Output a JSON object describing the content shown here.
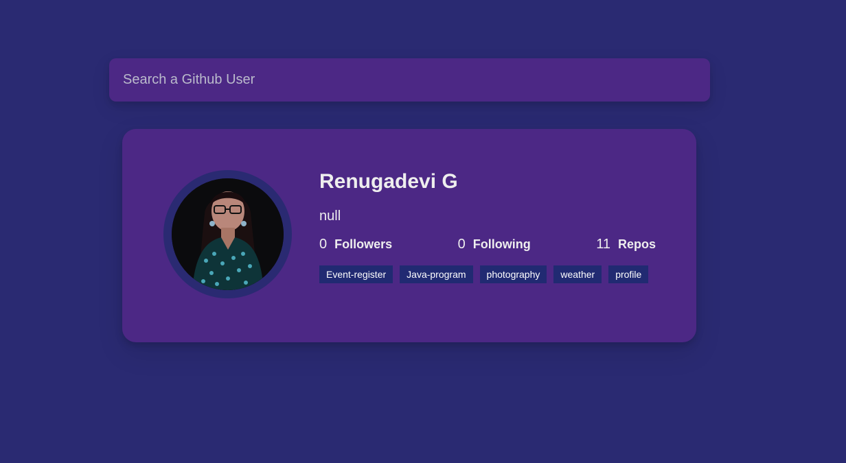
{
  "search": {
    "placeholder": "Search a Github User",
    "value": ""
  },
  "profile": {
    "avatar_icon": "user-avatar-photo",
    "name": "Renugadevi G",
    "bio": "null",
    "stats": [
      {
        "count": "0",
        "label": "Followers"
      },
      {
        "count": "0",
        "label": "Following"
      },
      {
        "count": "11",
        "label": "Repos"
      }
    ],
    "repos": [
      "Event-register",
      "Java-program",
      "photography",
      "weather",
      "profile"
    ]
  },
  "colors": {
    "background": "#2a2a72",
    "card": "#4c2885",
    "repo_tag": "#212a72",
    "text": "#eeeeee"
  }
}
